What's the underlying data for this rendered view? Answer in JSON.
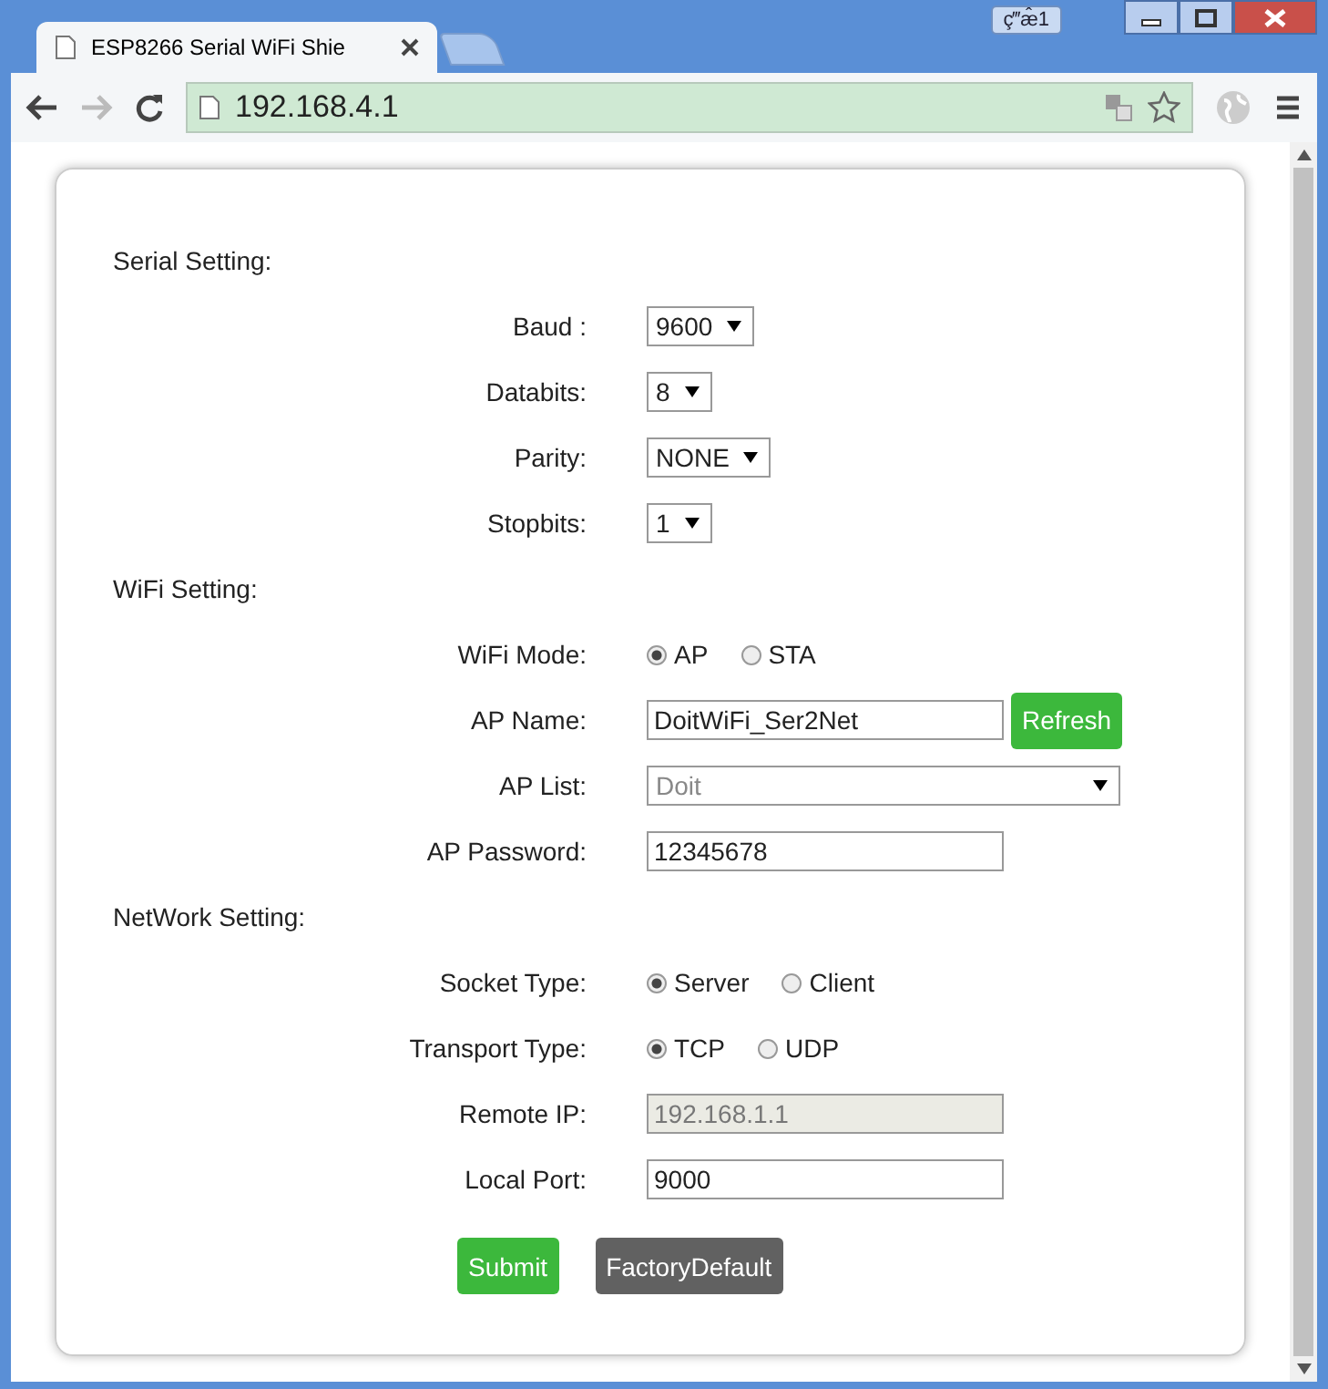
{
  "window": {
    "tab_title": "ESP8266 Serial WiFi Shie",
    "ime_indicator": "ç‴æ̂1",
    "address": "192.168.4.1"
  },
  "sections": [
    {
      "title": "Serial Setting:",
      "fields": [
        {
          "kind": "select",
          "label": "Baud :",
          "value": "9600"
        },
        {
          "kind": "select",
          "label": "Databits:",
          "value": "8"
        },
        {
          "kind": "select",
          "label": "Parity:",
          "value": "NONE"
        },
        {
          "kind": "select",
          "label": "Stopbits:",
          "value": "1"
        }
      ]
    },
    {
      "title": "WiFi Setting:",
      "fields": [
        {
          "kind": "radio",
          "label": "WiFi Mode:",
          "options": [
            {
              "label": "AP",
              "selected": true
            },
            {
              "label": "STA",
              "selected": false
            }
          ]
        },
        {
          "kind": "text",
          "label": "AP Name:",
          "value": "DoitWiFi_Ser2Net",
          "button": "Refresh"
        },
        {
          "kind": "wide-select",
          "label": "AP List:",
          "value": "Doit",
          "disabled": true
        },
        {
          "kind": "text",
          "label": "AP Password:",
          "value": "12345678"
        }
      ]
    },
    {
      "title": "NetWork Setting:",
      "fields": [
        {
          "kind": "radio",
          "label": "Socket Type:",
          "options": [
            {
              "label": "Server",
              "selected": true
            },
            {
              "label": "Client",
              "selected": false
            }
          ]
        },
        {
          "kind": "radio",
          "label": "Transport Type:",
          "options": [
            {
              "label": "TCP",
              "selected": true
            },
            {
              "label": "UDP",
              "selected": false
            }
          ]
        },
        {
          "kind": "text",
          "label": "Remote IP:",
          "value": "192.168.1.1",
          "disabled": true
        },
        {
          "kind": "text",
          "label": "Local Port:",
          "value": "9000"
        }
      ]
    }
  ],
  "buttons": [
    {
      "label": "Submit",
      "kind": "primary"
    },
    {
      "label": "FactoryDefault",
      "kind": "secondary"
    }
  ]
}
